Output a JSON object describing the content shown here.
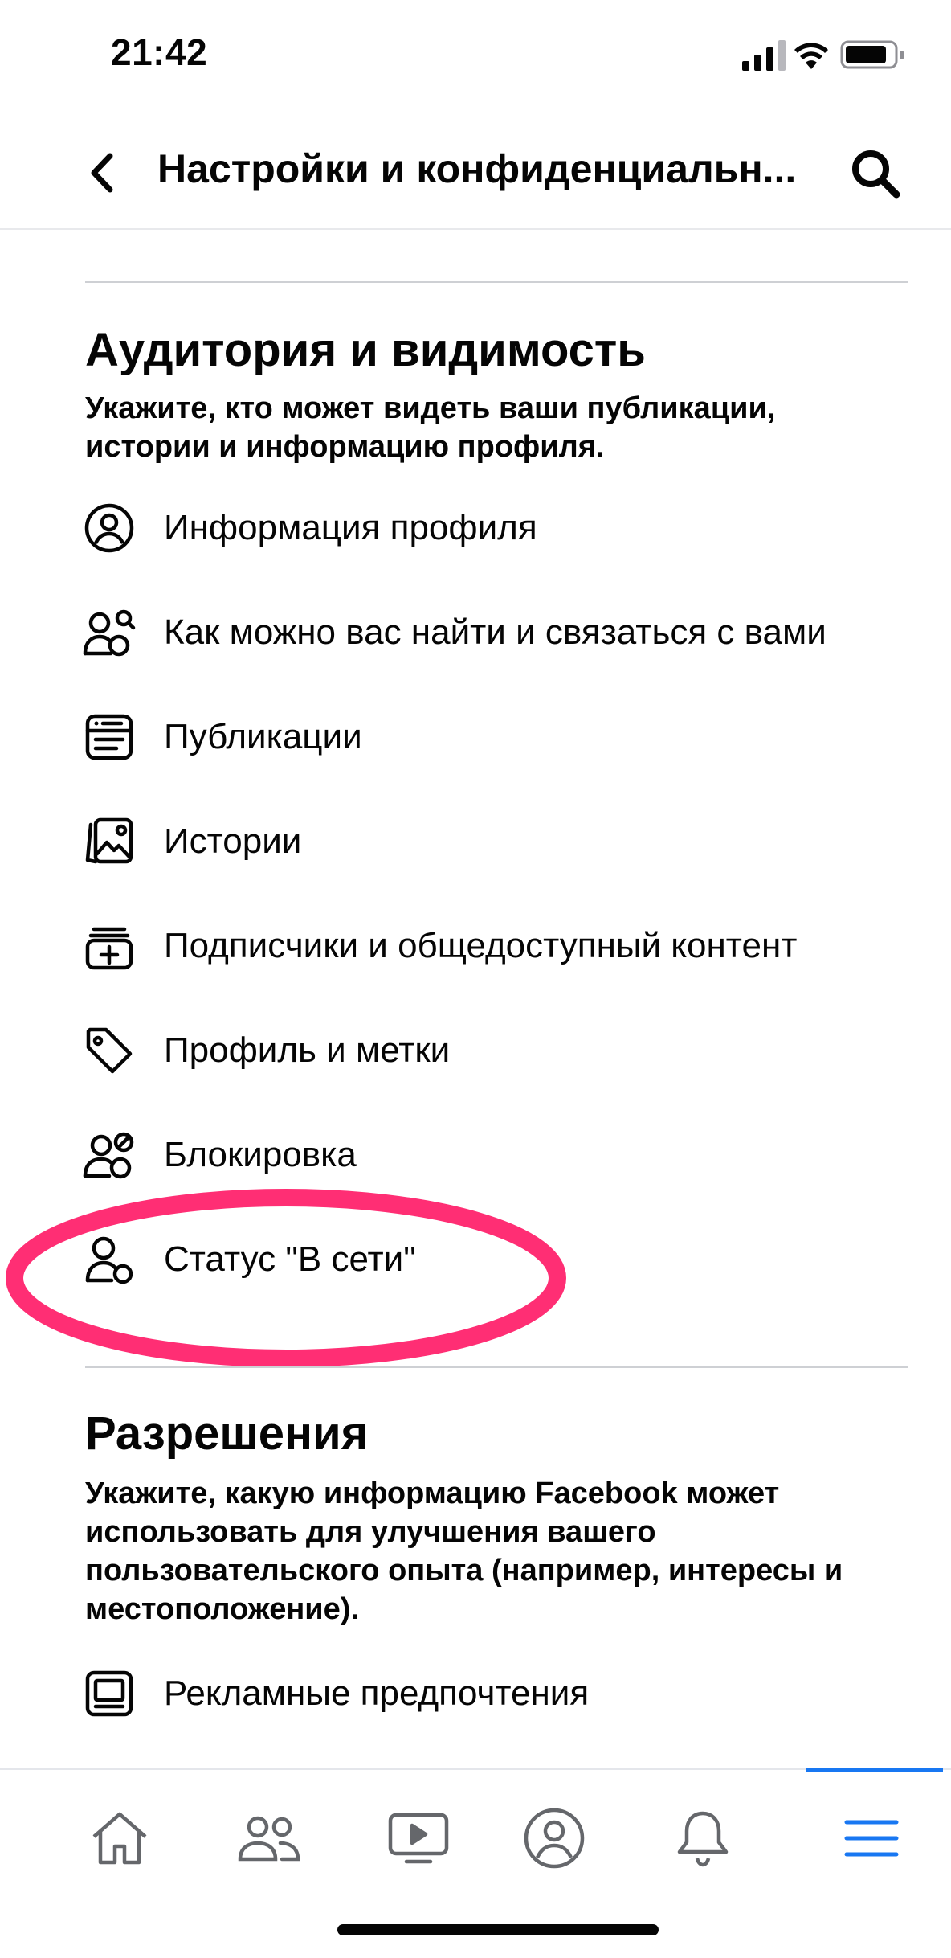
{
  "status_bar": {
    "time": "21:42"
  },
  "header": {
    "title": "Настройки и конфиденциальн..."
  },
  "audience_section": {
    "title": "Аудитория и видимость",
    "description": "Укажите, кто может видеть ваши публикации, истории и информацию профиля.",
    "items": [
      {
        "label": "Информация профиля",
        "icon": "profile-info-icon"
      },
      {
        "label": "Как можно вас найти и связаться с вами",
        "icon": "find-contact-icon"
      },
      {
        "label": "Публикации",
        "icon": "posts-icon"
      },
      {
        "label": "Истории",
        "icon": "stories-icon"
      },
      {
        "label": "Подписчики и общедоступный контент",
        "icon": "followers-icon"
      },
      {
        "label": "Профиль и метки",
        "icon": "tag-icon"
      },
      {
        "label": "Блокировка",
        "icon": "block-icon"
      },
      {
        "label": "Статус \"В сети\"",
        "icon": "active-status-icon"
      }
    ]
  },
  "permissions_section": {
    "title": "Разрешения",
    "description": "Укажите, какую информацию Facebook может использовать для улучшения вашего пользовательского опыта (например, интересы и местоположение).",
    "items": [
      {
        "label": "Рекламные предпочтения",
        "icon": "ad-preferences-icon"
      }
    ]
  },
  "tab_bar": {
    "tabs": [
      "home-icon",
      "friends-icon",
      "watch-icon",
      "profile-icon",
      "notifications-icon",
      "menu-icon"
    ],
    "active_tab": "menu-icon"
  },
  "colors": {
    "highlight": "#ff2e74",
    "accent": "#1877f2",
    "icon": "#050505",
    "tab_icon": "#65676b"
  }
}
